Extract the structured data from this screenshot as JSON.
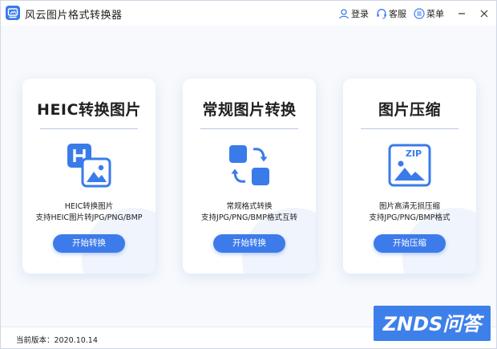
{
  "app": {
    "title": "风云图片格式转换器",
    "accent_color": "#3d7bea"
  },
  "titlebar": {
    "login_label": "登录",
    "support_label": "客服",
    "menu_label": "菜单",
    "icons": [
      "user-icon",
      "headset-icon",
      "menu-icon",
      "minimize-icon",
      "close-icon"
    ]
  },
  "cards": [
    {
      "title": "HEIC转换图片",
      "icon": "heic-image-icon",
      "desc_line1": "HEIC转换图片",
      "desc_line2": "支持HEIC图片转JPG/PNG/BMP",
      "button_label": "开始转换"
    },
    {
      "title": "常规图片转换",
      "icon": "convert-arrows-icon",
      "desc_line1": "常规格式转换",
      "desc_line2": "支持JPG/PNG/BMP格式互转",
      "button_label": "开始转换"
    },
    {
      "title": "图片压缩",
      "icon": "zip-image-icon",
      "desc_line1": "图片高清无损压缩",
      "desc_line2": "支持JPG/PNG/BMP格式",
      "button_label": "开始压缩"
    }
  ],
  "status": {
    "version_text": "当前版本：2020.10.14"
  },
  "watermark": {
    "text": "ZNDS问答"
  }
}
